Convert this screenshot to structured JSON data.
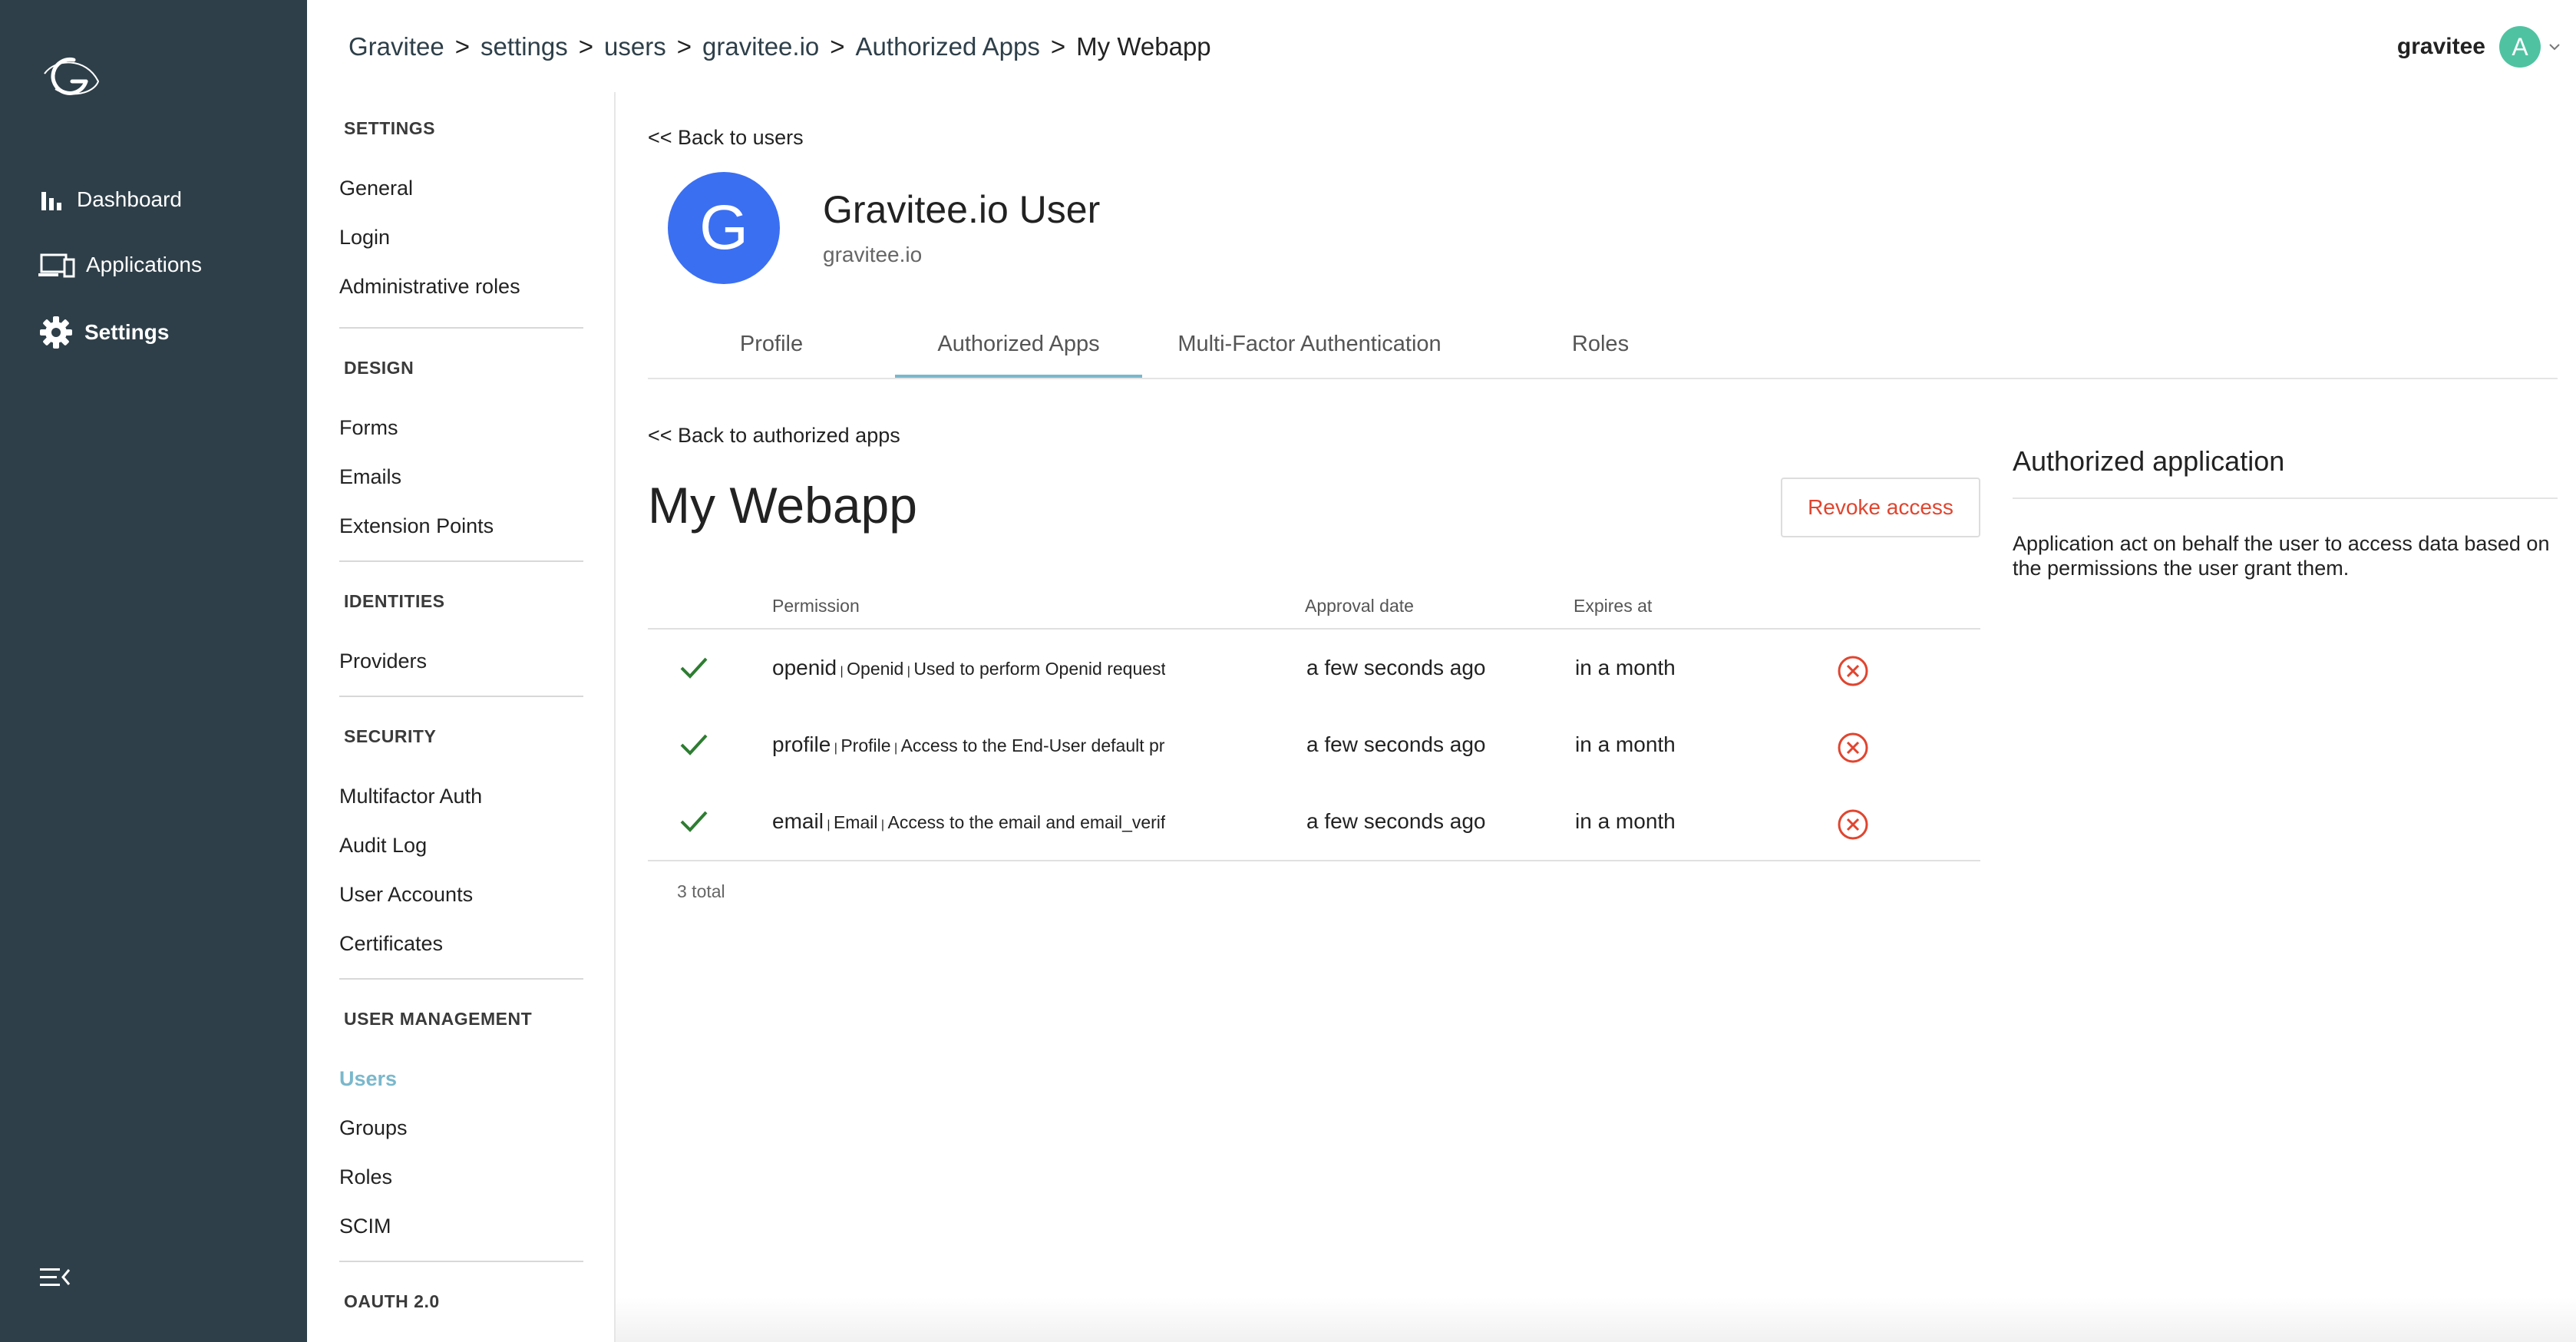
{
  "nav": {
    "items": [
      {
        "label": "Dashboard",
        "icon": "bar-chart-icon"
      },
      {
        "label": "Applications",
        "icon": "devices-icon"
      },
      {
        "label": "Settings",
        "icon": "gear-icon",
        "active": true
      }
    ]
  },
  "breadcrumb": {
    "items": [
      "Gravitee",
      "settings",
      "users",
      "gravitee.io",
      "Authorized Apps",
      "My Webapp"
    ],
    "separator": ">"
  },
  "header": {
    "username": "gravitee",
    "avatar_letter": "A",
    "avatar_color": "#4fc3a1"
  },
  "sidebar": {
    "sections": [
      {
        "title": "SETTINGS",
        "items": [
          "General",
          "Login",
          "Administrative roles"
        ]
      },
      {
        "title": "DESIGN",
        "items": [
          "Forms",
          "Emails",
          "Extension Points"
        ]
      },
      {
        "title": "IDENTITIES",
        "items": [
          "Providers"
        ]
      },
      {
        "title": "SECURITY",
        "items": [
          "Multifactor Auth",
          "Audit Log",
          "User Accounts",
          "Certificates"
        ]
      },
      {
        "title": "USER MANAGEMENT",
        "items": [
          "Users",
          "Groups",
          "Roles",
          "SCIM"
        ]
      },
      {
        "title": "OAUTH 2.0",
        "items": []
      }
    ],
    "active_item": "Users",
    "accent": "#7ab8cc"
  },
  "main": {
    "back_users": "<< Back to users",
    "user": {
      "avatar_letter": "G",
      "name": "Gravitee.io User",
      "domain": "gravitee.io",
      "avatar_color": "#3b6ff2"
    },
    "tabs": [
      "Profile",
      "Authorized Apps",
      "Multi-Factor Authentication",
      "Roles"
    ],
    "active_tab": "Authorized Apps",
    "back_apps": "<< Back to authorized apps",
    "app_title": "My Webapp",
    "revoke_label": "Revoke access",
    "table": {
      "headers": [
        "Permission",
        "Approval date",
        "Expires at"
      ],
      "rows": [
        {
          "key": "openid",
          "name": "Openid",
          "desc": "Used to perform Openid requests",
          "approved": "a few seconds ago",
          "expires": "in a month"
        },
        {
          "key": "profile",
          "name": "Profile",
          "desc": "Access to the End-User default profile Claims",
          "approved": "a few seconds ago",
          "expires": "in a month"
        },
        {
          "key": "email",
          "name": "Email",
          "desc": "Access to the email and email_verified Claims",
          "approved": "a few seconds ago",
          "expires": "in a month"
        }
      ],
      "total": "3 total"
    },
    "aside": {
      "title": "Authorized application",
      "text": "Application act on behalf the user to access data based on the permissions the user grant them."
    }
  },
  "colors": {
    "nav_bg": "#2e3f49",
    "check": "#2e7d32",
    "revoke": "#e0452f"
  }
}
